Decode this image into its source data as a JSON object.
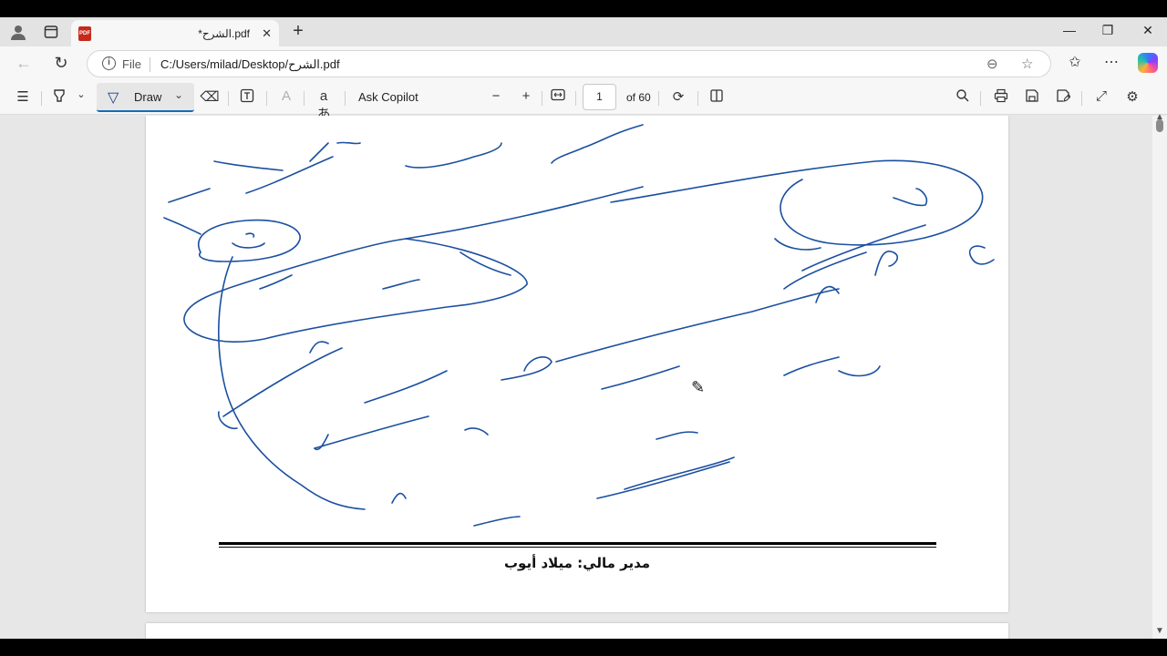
{
  "browser": {
    "tab": {
      "title": "*الشرح.pdf"
    },
    "address": {
      "scheme": "File",
      "url": "C:/Users/milad/Desktop/الشرح.pdf"
    }
  },
  "pdf_toolbar": {
    "draw_label": "Draw",
    "ask_copilot_label": "Ask Copilot",
    "page_number": "1",
    "page_total": "of 60"
  },
  "document": {
    "footer_text": "مدير مالي: ميلاد أيوب",
    "ink_color": "#1a4fa0"
  }
}
